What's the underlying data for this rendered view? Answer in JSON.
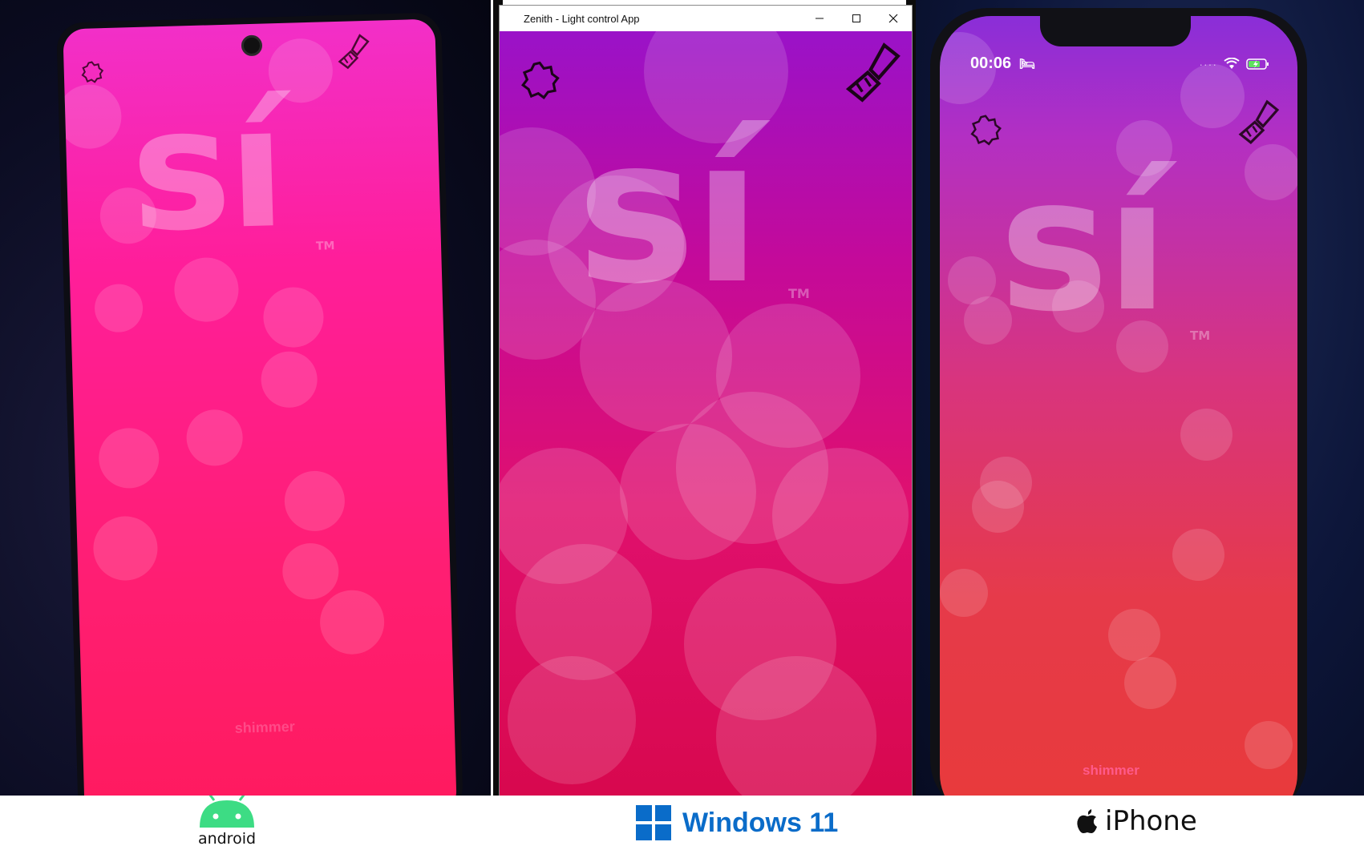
{
  "colors": {
    "android_screen": "#ff1e8a",
    "windows_background": "#c40a9a",
    "iphone_background": "#e63a4a",
    "windows_brand": "#0a6cc9",
    "android_brand": "#3ddc84"
  },
  "app": {
    "wordmark": "sí",
    "trademark": "TM",
    "footer_label": "shimmer",
    "left_icon": "settings-gear-icon",
    "right_icon": "paint-brush-icon"
  },
  "windows": {
    "window_title": "Zenith - Light control App"
  },
  "iphone": {
    "status_time": "00:06",
    "status_icons": [
      "sleep-bed-icon",
      "signal-dots-icon",
      "wifi-icon",
      "battery-charging-icon"
    ]
  },
  "platform_logos": {
    "android": "android",
    "windows": "Windows 11",
    "iphone": "iPhone"
  }
}
